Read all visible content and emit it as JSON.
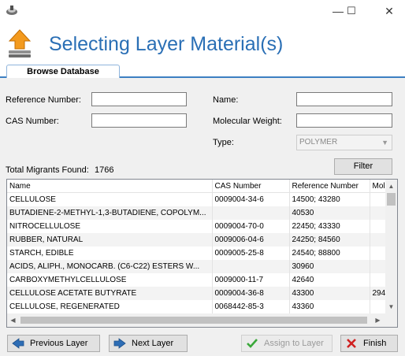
{
  "window": {
    "minimize_glyph": "—",
    "maximize_glyph": "☐",
    "close_glyph": "✕"
  },
  "header": {
    "title": "Selecting Layer Material(s)"
  },
  "tabs": [
    {
      "label": "Browse Database"
    }
  ],
  "form": {
    "reference_number_label": "Reference Number:",
    "reference_number_value": "",
    "cas_number_label": "CAS Number:",
    "cas_number_value": "",
    "name_label": "Name:",
    "name_value": "",
    "molecular_weight_label": "Molecular Weight:",
    "molecular_weight_value": "",
    "type_label": "Type:",
    "type_value": "POLYMER",
    "filter_label": "Filter"
  },
  "summary": {
    "total_label": "Total Migrants Found:",
    "total_value": "1766"
  },
  "table": {
    "columns": [
      "Name",
      "CAS Number",
      "Reference Number",
      "Mol"
    ],
    "rows": [
      [
        "CELLULOSE",
        "0009004-34-6",
        "14500; 43280",
        ""
      ],
      [
        "BUTADIENE-2-METHYL-1,3-BUTADIENE, COPOLYM...",
        "",
        "40530",
        ""
      ],
      [
        "NITROCELLULOSE",
        "0009004-70-0",
        "22450; 43330",
        ""
      ],
      [
        "RUBBER, NATURAL",
        "0009006-04-6",
        "24250; 84560",
        ""
      ],
      [
        "STARCH, EDIBLE",
        "0009005-25-8",
        "24540; 88800",
        ""
      ],
      [
        "ACIDS, ALIPH., MONOCARB. (C6-C22) ESTERS W...",
        "",
        "30960",
        ""
      ],
      [
        "CARBOXYMETHYLCELLULOSE",
        "0009000-11-7",
        "42640",
        ""
      ],
      [
        "CELLULOSE ACETATE BUTYRATE",
        "0009004-36-8",
        "43300",
        "294"
      ],
      [
        "CELLULOSE, REGENERATED",
        "0068442-85-3",
        "43360",
        ""
      ]
    ]
  },
  "buttons": {
    "previous": "Previous Layer",
    "next": "Next Layer",
    "assign": "Assign to Layer",
    "finish": "Finish"
  },
  "colors": {
    "title": "#2a6fb5",
    "tab_accent": "#3c7fc2",
    "nav_arrow": "#2d6db5",
    "check": "#3aa83a",
    "close_x": "#d02020"
  }
}
